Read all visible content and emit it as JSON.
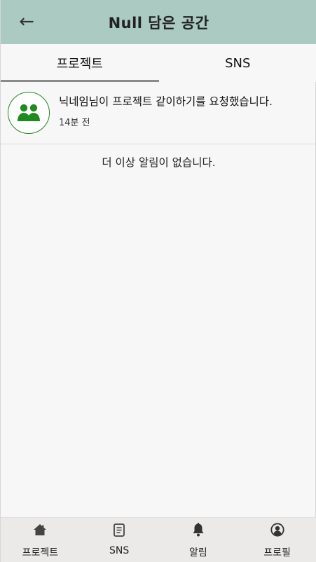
{
  "header": {
    "title": "Null 담은 공간",
    "back_icon": "←"
  },
  "tabs": [
    {
      "label": "프로젝트",
      "active": true
    },
    {
      "label": "SNS",
      "active": false
    }
  ],
  "notifications": [
    {
      "icon": "users-icon",
      "message": "닉네임님이 프로젝트 같이하기를 요청했습니다.",
      "time": "14분 전"
    }
  ],
  "empty_message": "더 이상 알림이 없습니다.",
  "bottom_nav": [
    {
      "label": "프로젝트",
      "icon": "home-icon"
    },
    {
      "label": "SNS",
      "icon": "document-icon"
    },
    {
      "label": "알림",
      "icon": "bell-icon"
    },
    {
      "label": "프로필",
      "icon": "user-circle-icon"
    }
  ],
  "colors": {
    "header_bg": "#abcac2",
    "accent_green": "#1f8a1f",
    "tab_indicator": "#8a8a8a",
    "nav_bg": "#ebeae8"
  }
}
